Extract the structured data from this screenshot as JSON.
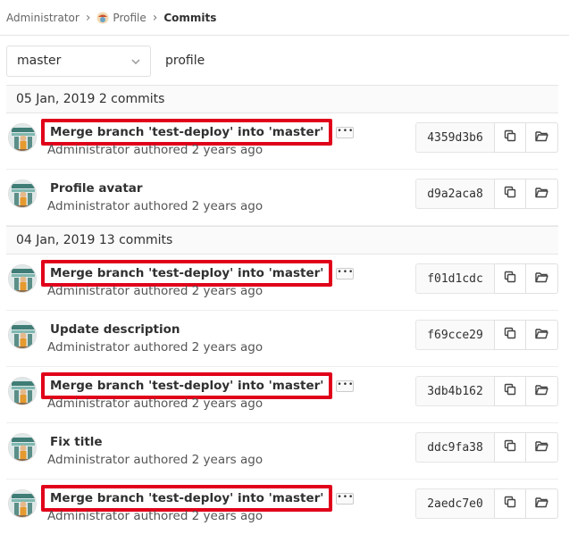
{
  "breadcrumb": {
    "root": "Administrator",
    "project": "Profile",
    "current": "Commits"
  },
  "controls": {
    "branch": "master",
    "path": "profile"
  },
  "days": [
    {
      "date": "05 Jan, 2019",
      "count": "2 commits"
    },
    {
      "date": "04 Jan, 2019",
      "count": "13 commits"
    }
  ],
  "commits": [
    {
      "title": "Merge branch 'test-deploy' into 'master'",
      "meta": "Administrator authored 2 years ago",
      "sha": "4359d3b6",
      "highlighted": true,
      "has_ellipsis": true
    },
    {
      "title": "Profile avatar",
      "meta": "Administrator authored 2 years ago",
      "sha": "d9a2aca8",
      "highlighted": false,
      "has_ellipsis": false
    },
    {
      "title": "Merge branch 'test-deploy' into 'master'",
      "meta": "Administrator authored 2 years ago",
      "sha": "f01d1cdc",
      "highlighted": true,
      "has_ellipsis": true
    },
    {
      "title": "Update description",
      "meta": "Administrator authored 2 years ago",
      "sha": "f69cce29",
      "highlighted": false,
      "has_ellipsis": false
    },
    {
      "title": "Merge branch 'test-deploy' into 'master'",
      "meta": "Administrator authored 2 years ago",
      "sha": "3db4b162",
      "highlighted": true,
      "has_ellipsis": true
    },
    {
      "title": "Fix title",
      "meta": "Administrator authored 2 years ago",
      "sha": "ddc9fa38",
      "highlighted": false,
      "has_ellipsis": false
    },
    {
      "title": "Merge branch 'test-deploy' into 'master'",
      "meta": "Administrator authored 2 years ago",
      "sha": "2aedc7e0",
      "highlighted": true,
      "has_ellipsis": true
    }
  ],
  "icons": {
    "expand": "ellipsis-icon",
    "copy": "copy-icon",
    "browse": "folder-open-icon",
    "branch_dropdown": "chevron-down-icon"
  },
  "colors": {
    "highlight": "#e0001a",
    "day_header_bg": "#fafafa"
  }
}
